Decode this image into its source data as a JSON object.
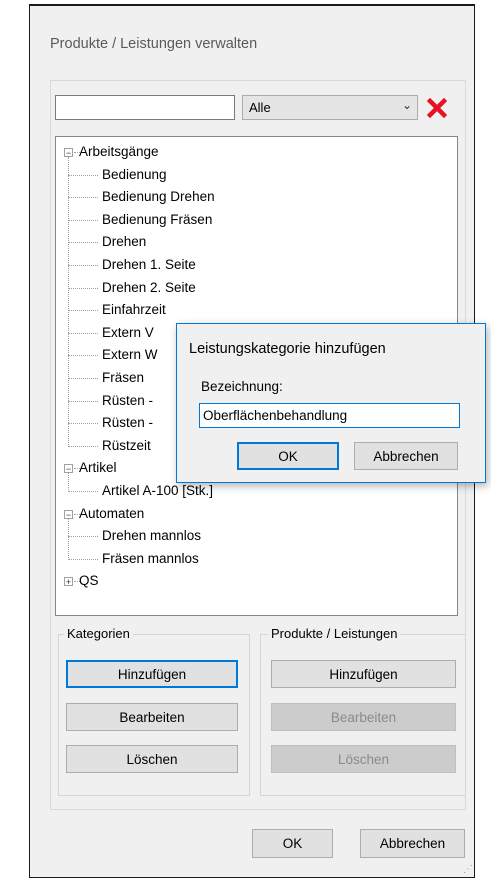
{
  "window": {
    "title": "Produkte / Leistungen verwalten"
  },
  "filter": {
    "search_value": "",
    "selected": "Alle"
  },
  "tree": [
    {
      "label": "Arbeitsgänge",
      "expander": "−",
      "children": [
        "Bedienung",
        "Bedienung Drehen",
        "Bedienung Fräsen",
        "Drehen",
        "Drehen 1. Seite",
        "Drehen 2. Seite",
        "Einfahrzeit",
        "Extern V",
        "Extern W",
        "Fräsen",
        "Rüsten -",
        "Rüsten -",
        "Rüstzeit"
      ]
    },
    {
      "label": "Artikel",
      "expander": "−",
      "children": [
        "Artikel A-100 [Stk.]"
      ]
    },
    {
      "label": "Automaten",
      "expander": "−",
      "children": [
        "Drehen mannlos",
        "Fräsen mannlos"
      ]
    },
    {
      "label": "QS",
      "expander": "+",
      "children": []
    }
  ],
  "kategorien": {
    "title": "Kategorien",
    "add_label": "Hinzufügen",
    "edit_label": "Bearbeiten",
    "delete_label": "Löschen"
  },
  "produkte": {
    "title": "Produkte / Leistungen",
    "add_label": "Hinzufügen",
    "edit_label": "Bearbeiten",
    "delete_label": "Löschen"
  },
  "footer": {
    "ok_label": "OK",
    "cancel_label": "Abbrechen"
  },
  "dialog": {
    "title": "Leistungskategorie hinzufügen",
    "field_label": "Bezeichnung:",
    "field_value": "Oberflächenbehandlung",
    "ok_label": "OK",
    "cancel_label": "Abbrechen"
  },
  "colors": {
    "accent": "#0078d7",
    "clear_icon": "#e81123"
  }
}
